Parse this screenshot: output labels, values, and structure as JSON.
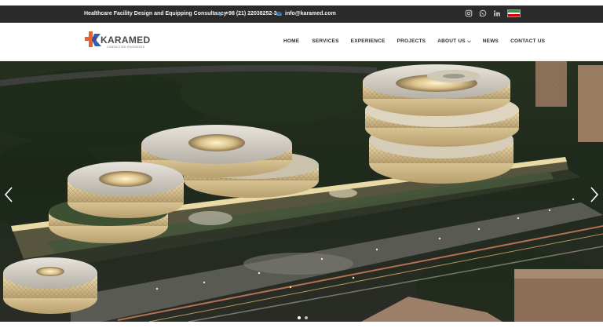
{
  "topbar": {
    "tagline": "Healthcare Facility Design and Equipping Consultancy",
    "phone": "+98 (21) 22038252-3",
    "email": "info@karamed.com",
    "social_icons": [
      "instagram-icon",
      "whatsapp-icon",
      "linkedin-icon"
    ],
    "language_flag": "iran-flag"
  },
  "logo": {
    "wordmark": "KARAMED",
    "subtitle": "CONSULTING ENGINEERS",
    "brand_color": "#e8612c",
    "brand_color_2": "#1f4ea3"
  },
  "nav": {
    "items": [
      {
        "label": "HOME"
      },
      {
        "label": "SERVICES"
      },
      {
        "label": "EXPERIENCE"
      },
      {
        "label": "PROJECTS"
      },
      {
        "label": "ABOUT US",
        "has_dropdown": true
      },
      {
        "label": "NEWS"
      },
      {
        "label": "CONTACT US"
      }
    ]
  },
  "slider": {
    "prev_icon": "chevron-left-icon",
    "next_icon": "chevron-right-icon",
    "slides_count": 2,
    "active_slide": 1
  },
  "colors": {
    "topbar_bg": "#2b2b2b",
    "accent_blue": "#3a8fd6"
  }
}
